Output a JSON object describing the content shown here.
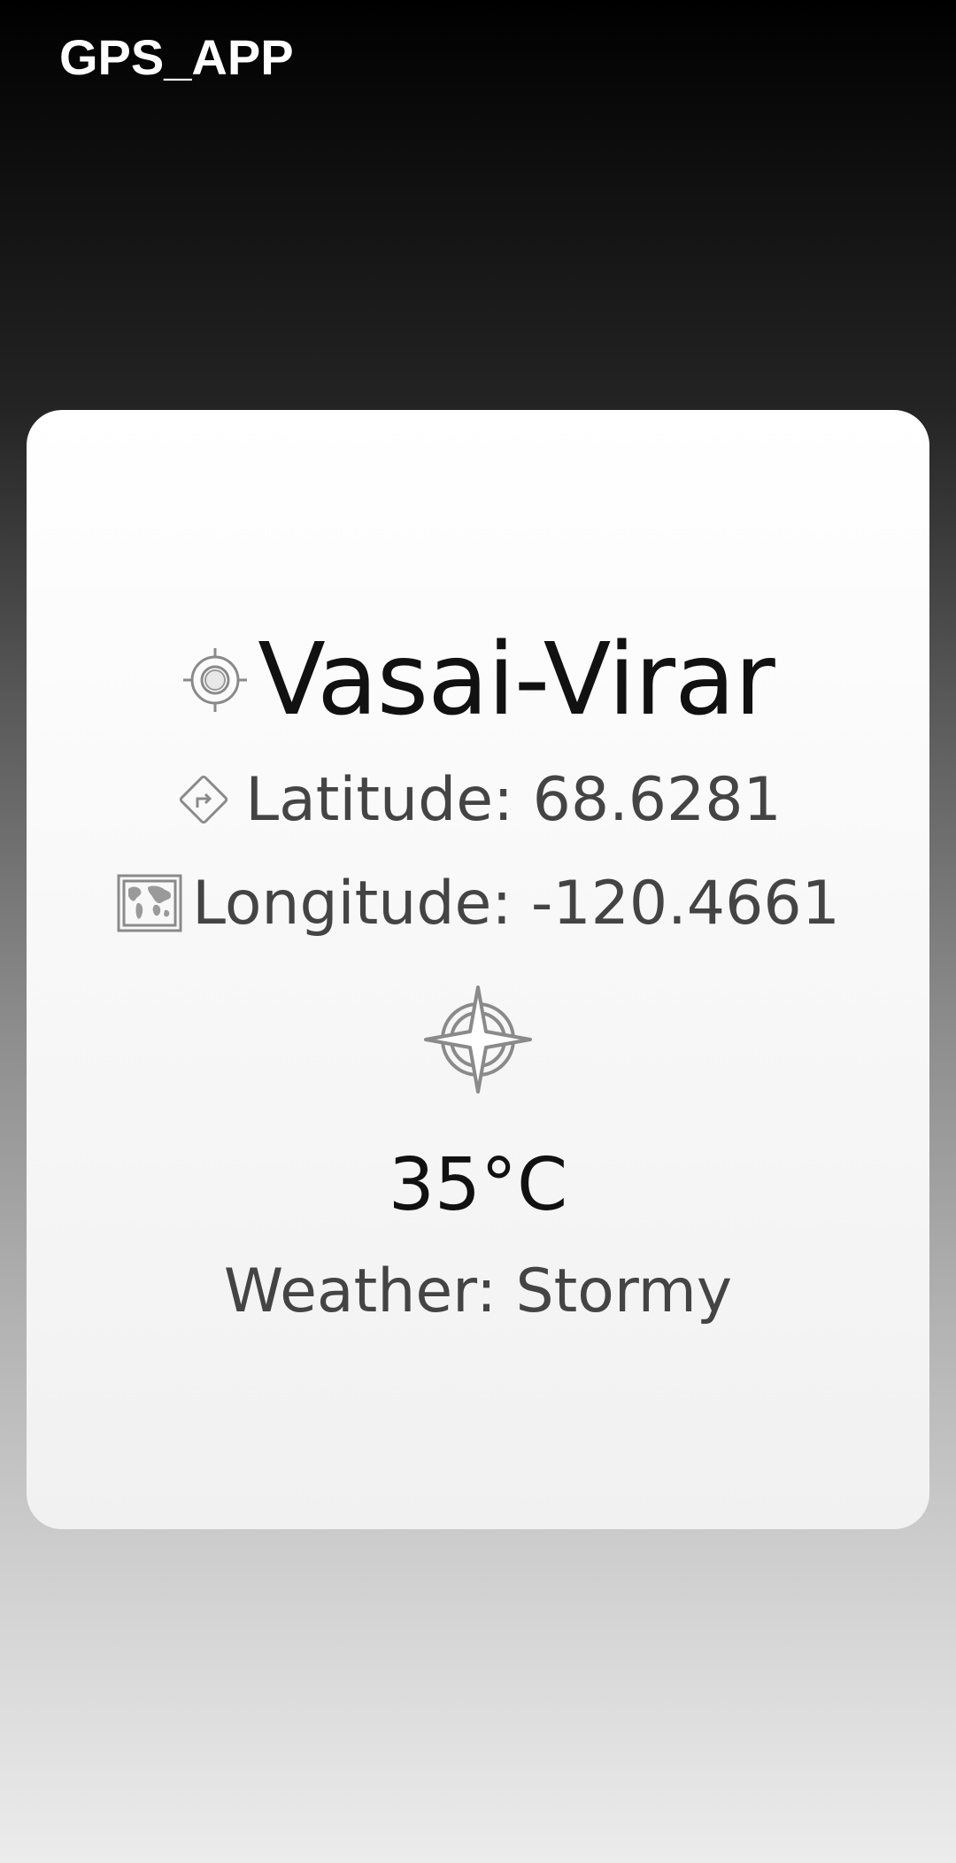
{
  "app": {
    "title": "GPS_APP"
  },
  "location": {
    "city": "Vasai-Virar",
    "city_icon": "gps-target-icon",
    "latitude_text": "Latitude: 68.6281",
    "latitude_icon": "direction-sign-icon",
    "longitude_text": "Longitude: -120.4661",
    "longitude_icon": "world-map-icon"
  },
  "weather": {
    "compass_icon": "compass-star-icon",
    "temperature": "35°C",
    "condition_text": "Weather: Stormy"
  },
  "colors": {
    "title_text": "#ffffff",
    "card_background": "#f7f7f7",
    "primary_text": "#111111",
    "secondary_text": "#444444",
    "icon_stroke": "#888888"
  }
}
